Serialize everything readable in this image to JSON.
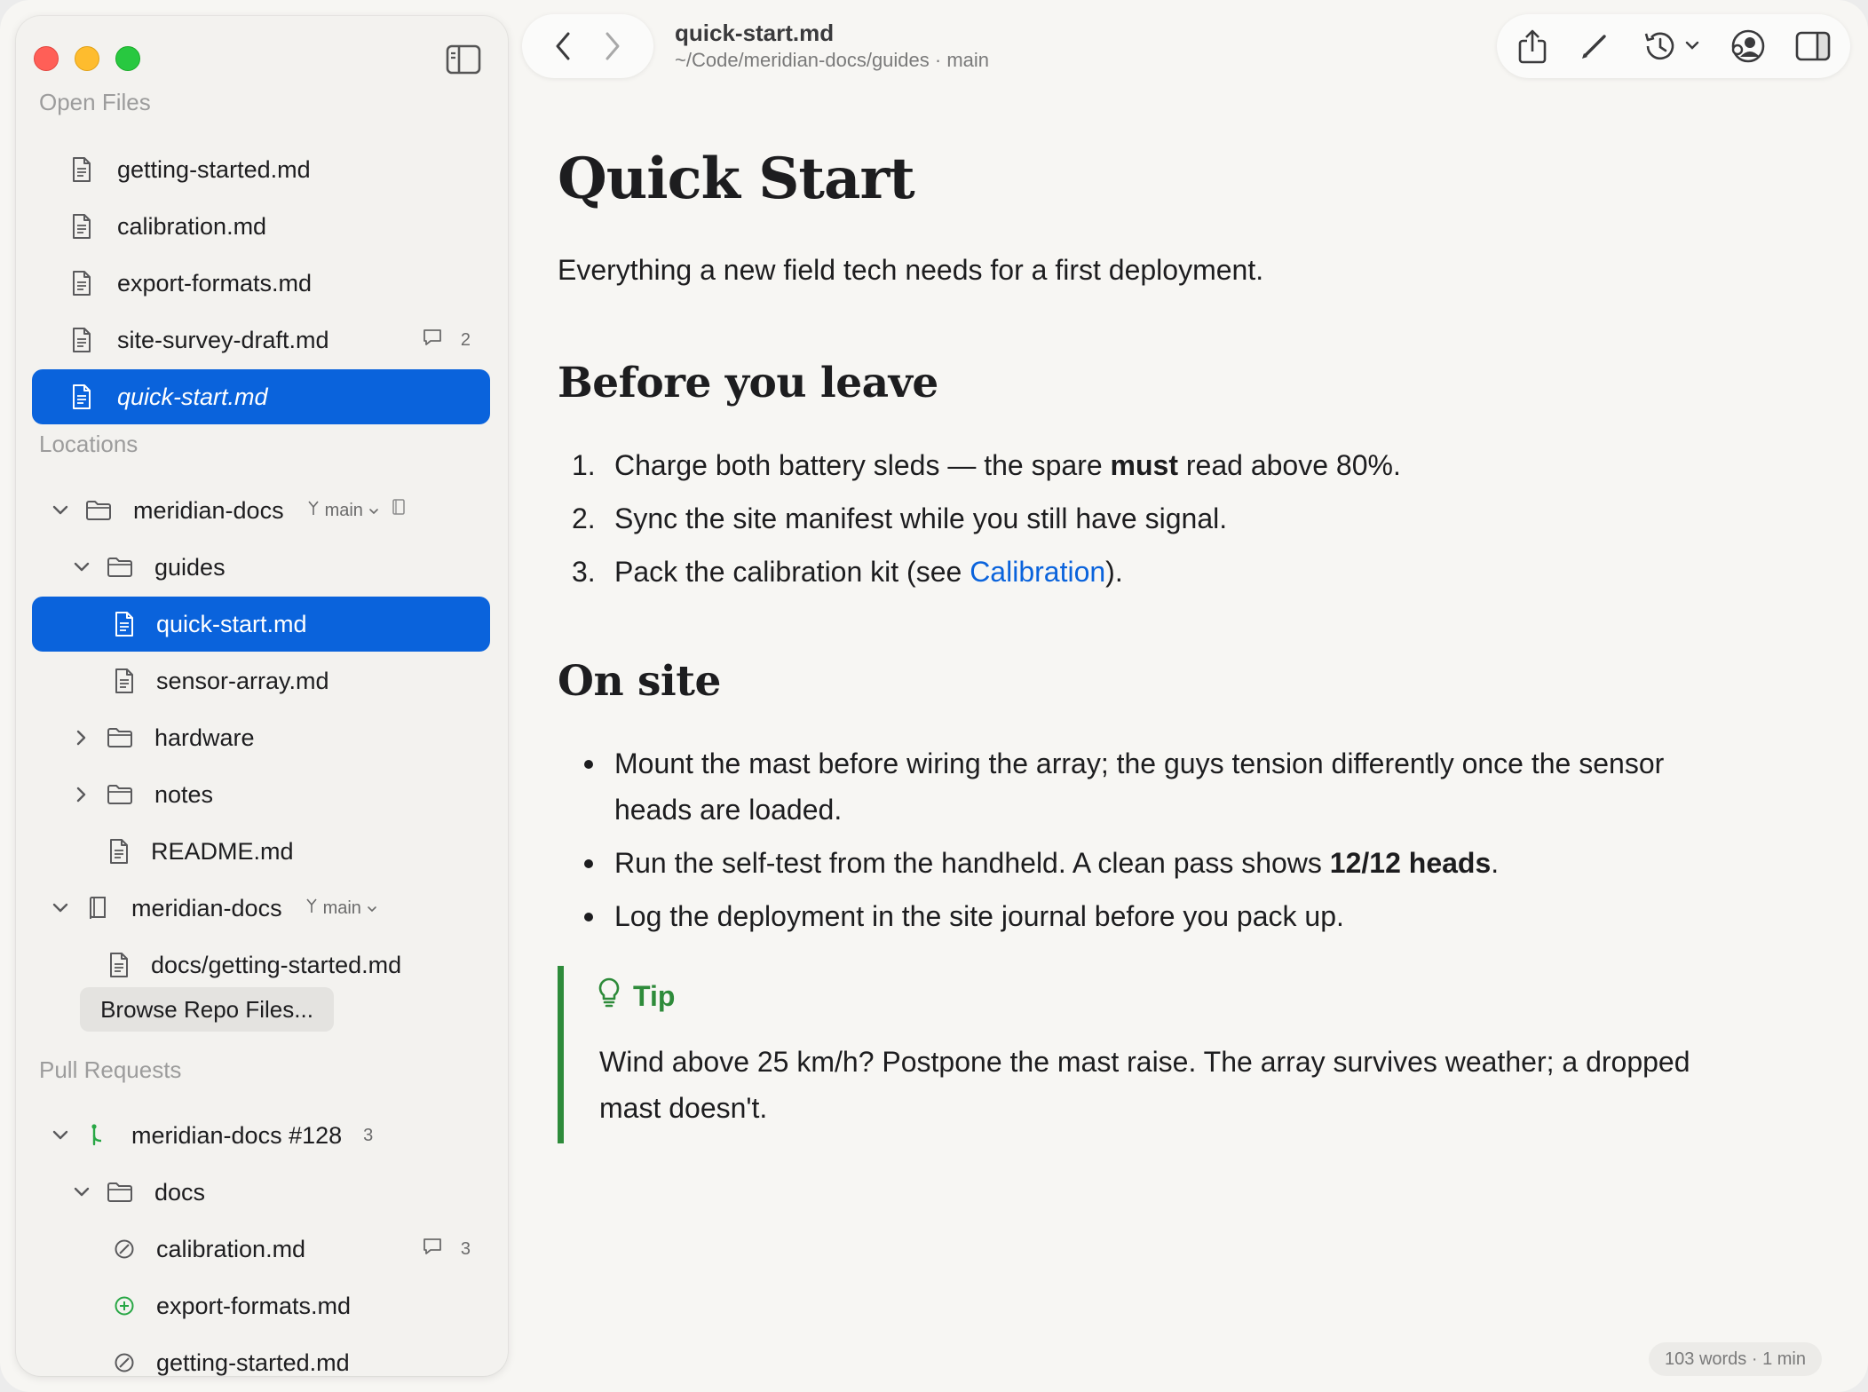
{
  "sidebar": {
    "open_files_title": "Open Files",
    "open_files": [
      {
        "label": "getting-started.md"
      },
      {
        "label": "calibration.md"
      },
      {
        "label": "export-formats.md"
      },
      {
        "label": "site-survey-draft.md",
        "comments": "2"
      },
      {
        "label": "quick-start.md",
        "selected": true
      }
    ],
    "locations_title": "Locations",
    "repo1": {
      "label": "meridian-docs",
      "branch": "main"
    },
    "guides": {
      "label": "guides"
    },
    "guides_files": [
      {
        "label": "quick-start.md",
        "selected": true
      },
      {
        "label": "sensor-array.md"
      }
    ],
    "hardware": {
      "label": "hardware"
    },
    "notes": {
      "label": "notes"
    },
    "readme": {
      "label": "README.md"
    },
    "repo2": {
      "label": "meridian-docs",
      "branch": "main"
    },
    "repo2_file": {
      "label": "docs/getting-started.md"
    },
    "browse_label": "Browse Repo Files...",
    "pull_requests_title": "Pull Requests",
    "pr": {
      "label": "meridian-docs #128",
      "count": "3"
    },
    "pr_folder": {
      "label": "docs"
    },
    "pr_files": [
      {
        "label": "calibration.md",
        "status": "modified",
        "comments": "3"
      },
      {
        "label": "export-formats.md",
        "status": "added"
      },
      {
        "label": "getting-started.md",
        "status": "modified"
      }
    ]
  },
  "toolbar": {
    "doc_title": "quick-start.md",
    "doc_path": "~/Code/meridian-docs/guides · main",
    "icons": [
      "back-icon",
      "forward-icon",
      "share-icon",
      "edit-icon",
      "history-icon",
      "collaborator-icon",
      "inspector-icon"
    ]
  },
  "document": {
    "title": "Quick Start",
    "subtitle": "Everything a new field tech needs for a first deployment.",
    "section1": {
      "heading": "Before you leave",
      "items": [
        {
          "num": "1.",
          "pre": "Charge both battery sleds — the spare ",
          "bold": "must",
          "post": " read above 80%."
        },
        {
          "num": "2.",
          "text": "Sync the site manifest while you still have signal."
        },
        {
          "num": "3.",
          "pre": "Pack the calibration kit (see ",
          "link": "Calibration",
          "post": ")."
        }
      ]
    },
    "section2": {
      "heading": "On site",
      "items": [
        {
          "text": "Mount the mast before wiring the array; the guys tension differently once the sensor heads are loaded."
        },
        {
          "pre": "Run the self-test from the handheld. A clean pass shows ",
          "bold": "12/12 heads",
          "post": "."
        },
        {
          "text": "Log the deployment in the site journal before you pack up."
        }
      ]
    },
    "tip": {
      "label": "Tip",
      "text": "Wind above 25 km/h? Postpone the mast raise. The array survives weather; a dropped mast doesn't."
    }
  },
  "status": {
    "word_count": "103 words · 1 min"
  },
  "colors": {
    "accent": "#0a63dc",
    "tip": "#2e8b3a",
    "added": "#28a745"
  }
}
